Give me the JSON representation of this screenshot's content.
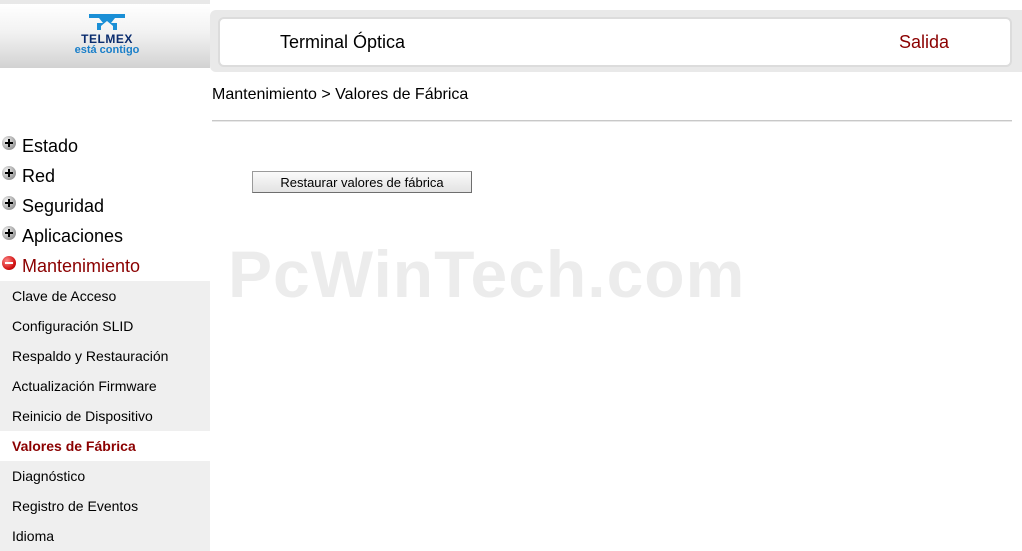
{
  "logo": {
    "brand": "TELMEX",
    "slogan": "está contigo"
  },
  "header": {
    "title": "Terminal Óptica",
    "exit_label": "Salida"
  },
  "breadcrumb": "Mantenimiento > Valores de Fábrica",
  "sidebar": {
    "groups": [
      {
        "label": "Estado",
        "icon": "plus-circle-icon"
      },
      {
        "label": "Red",
        "icon": "plus-circle-icon"
      },
      {
        "label": "Seguridad",
        "icon": "plus-circle-icon"
      },
      {
        "label": "Aplicaciones",
        "icon": "plus-circle-icon"
      },
      {
        "label": "Mantenimiento",
        "icon": "minus-circle-icon",
        "expanded": true
      }
    ],
    "subitems": [
      {
        "label": "Clave de Acceso"
      },
      {
        "label": "Configuración SLID"
      },
      {
        "label": "Respaldo y Restauración"
      },
      {
        "label": "Actualización Firmware"
      },
      {
        "label": "Reinicio de Dispositivo"
      },
      {
        "label": "Valores de Fábrica",
        "selected": true
      },
      {
        "label": "Diagnóstico"
      },
      {
        "label": "Registro de Eventos"
      },
      {
        "label": "Idioma"
      }
    ]
  },
  "content": {
    "restore_button": "Restaurar valores de fábrica"
  },
  "watermark": "PcWinTech.com",
  "colors": {
    "accent": "#8b0000",
    "brand_blue": "#0a2c6e",
    "slogan_blue": "#1a7fc9",
    "submenu_bg": "#efefef"
  }
}
